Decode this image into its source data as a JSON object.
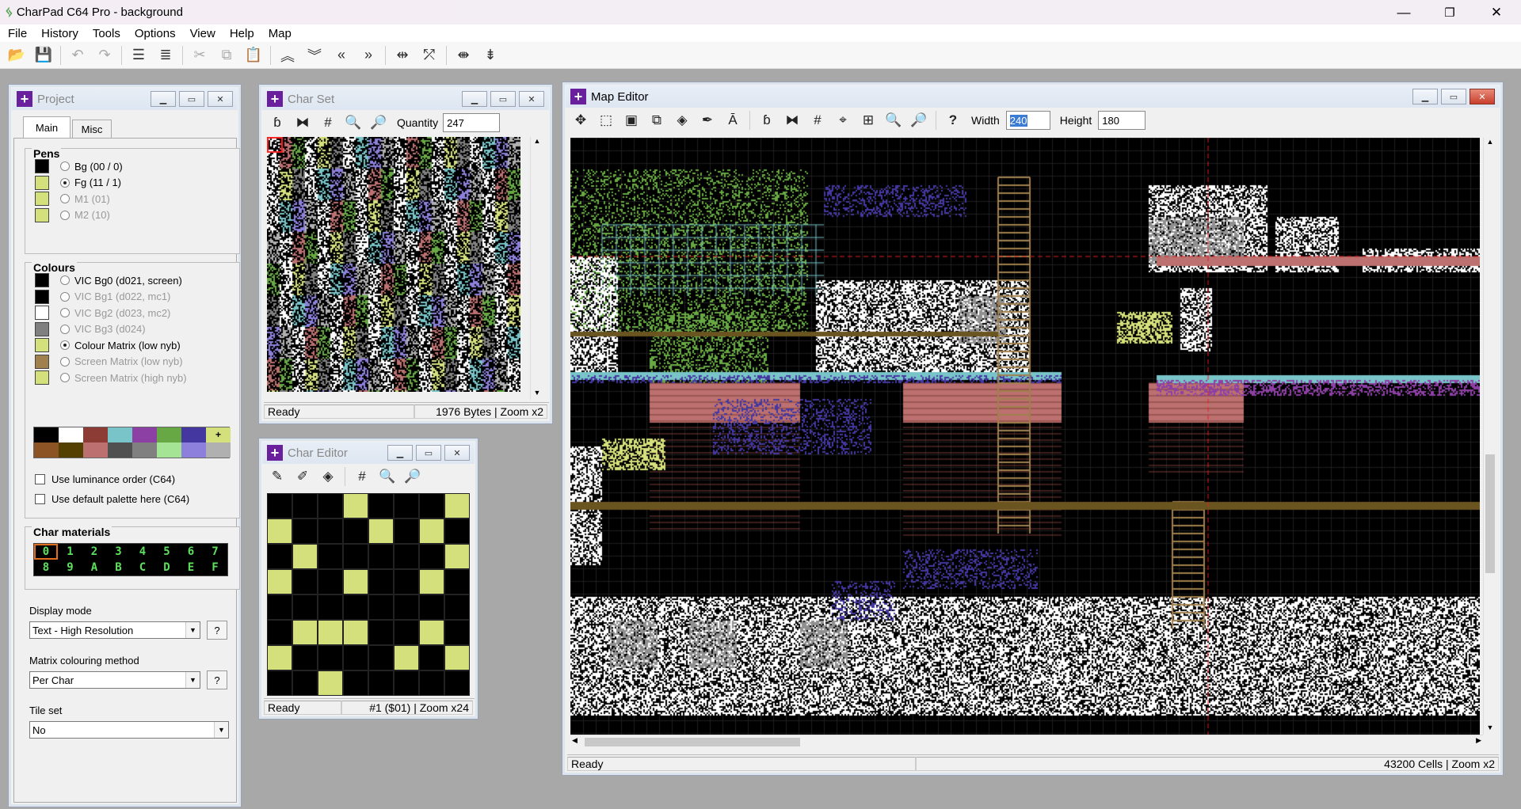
{
  "window": {
    "title": "CharPad C64 Pro - background",
    "min": "—",
    "max": "❐",
    "close": "✕"
  },
  "menu": [
    "File",
    "History",
    "Tools",
    "Options",
    "View",
    "Help",
    "Map"
  ],
  "project": {
    "title": "Project",
    "tabs": [
      "Main",
      "Misc"
    ],
    "pens_label": "Pens",
    "pens": [
      {
        "label": "Bg (00 / 0)",
        "color": "#000000",
        "selected": false,
        "enabled": true
      },
      {
        "label": "Fg (11 / 1)",
        "color": "#d4e07c",
        "selected": true,
        "enabled": true
      },
      {
        "label": "M1 (01)",
        "color": "#d4e07c",
        "selected": false,
        "enabled": false
      },
      {
        "label": "M2 (10)",
        "color": "#d4e07c",
        "selected": false,
        "enabled": false
      }
    ],
    "colours_label": "Colours",
    "colours": [
      {
        "label": "VIC Bg0 (d021, screen)",
        "color": "#000000",
        "selected": false,
        "enabled": true
      },
      {
        "label": "VIC Bg1 (d022, mc1)",
        "color": "#000000",
        "selected": false,
        "enabled": false
      },
      {
        "label": "VIC Bg2 (d023, mc2)",
        "color": "#ffffff",
        "selected": false,
        "enabled": false
      },
      {
        "label": "VIC Bg3 (d024)",
        "color": "#808080",
        "selected": false,
        "enabled": false
      },
      {
        "label": "Colour Matrix (low nyb)",
        "color": "#d4e07c",
        "selected": true,
        "enabled": true
      },
      {
        "label": "Screen Matrix (low nyb)",
        "color": "#a0804c",
        "selected": false,
        "enabled": false
      },
      {
        "label": "Screen Matrix (high nyb)",
        "color": "#d4e07c",
        "selected": false,
        "enabled": false
      }
    ],
    "palette_top": [
      "#000000",
      "#ffffff",
      "#8c3c34",
      "#78c4c8",
      "#8c40a4",
      "#68a844",
      "#4438a0",
      "#d4e07c"
    ],
    "palette_bottom": [
      "#8c5424",
      "#544000",
      "#bc7070",
      "#505050",
      "#808080",
      "#a4e494",
      "#8c80dc",
      "#b0b0b0"
    ],
    "use_luminance": "Use luminance order (C64)",
    "use_default_palette": "Use default palette here (C64)",
    "materials_label": "Char materials",
    "materials_row1": [
      "0",
      "1",
      "2",
      "3",
      "4",
      "5",
      "6",
      "7"
    ],
    "materials_row2": [
      "8",
      "9",
      "A",
      "B",
      "C",
      "D",
      "E",
      "F"
    ],
    "display_mode_label": "Display mode",
    "display_mode_value": "Text - High Resolution",
    "matrix_label": "Matrix colouring method",
    "matrix_value": "Per Char",
    "tileset_label": "Tile set",
    "tileset_value": "No",
    "help": "?"
  },
  "charset": {
    "title": "Char Set",
    "quantity_label": "Quantity",
    "quantity_value": "247",
    "status_left": "Ready",
    "status_right": "1976 Bytes | Zoom x2"
  },
  "chareditor": {
    "title": "Char Editor",
    "status_left": "Ready",
    "status_right": "#1 ($01) | Zoom x24",
    "pixels": [
      [
        0,
        0,
        0,
        1,
        0,
        0,
        0,
        1
      ],
      [
        1,
        0,
        0,
        0,
        1,
        0,
        1,
        0
      ],
      [
        0,
        1,
        0,
        0,
        0,
        0,
        0,
        1
      ],
      [
        1,
        0,
        0,
        1,
        0,
        0,
        1,
        0
      ],
      [
        0,
        0,
        0,
        0,
        0,
        0,
        0,
        0
      ],
      [
        0,
        1,
        1,
        1,
        0,
        0,
        1,
        0
      ],
      [
        1,
        0,
        0,
        0,
        0,
        1,
        0,
        1
      ],
      [
        0,
        0,
        1,
        0,
        0,
        0,
        0,
        0
      ]
    ],
    "fg": "#d4e07c"
  },
  "mapeditor": {
    "title": "Map Editor",
    "width_label": "Width",
    "width_value": "240",
    "height_label": "Height",
    "height_value": "180",
    "status_left": "Ready",
    "status_right": "43200 Cells | Zoom x2"
  }
}
